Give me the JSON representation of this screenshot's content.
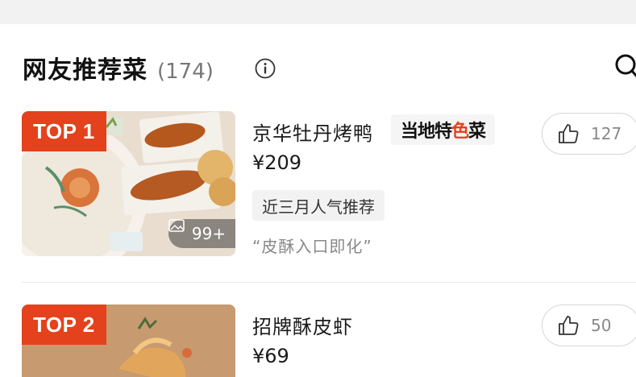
{
  "section": {
    "title": "网友推荐菜",
    "count": "(174)",
    "icons": {
      "info": "info-circle-icon",
      "search": "search-icon"
    }
  },
  "dishes": [
    {
      "rank": "TOP 1",
      "name": "京华牡丹烤鸭",
      "local_tag": {
        "text_a": "当地特",
        "text_b": "色",
        "text_c": "菜"
      },
      "price": "¥209",
      "recommend_tag": "近三月人气推荐",
      "quote": "“皮酥入口即化”",
      "photo_count": "99+",
      "likes": "127"
    },
    {
      "rank": "TOP 2",
      "name": "招牌酥皮虾",
      "price": "¥69",
      "likes": "50"
    }
  ],
  "colors": {
    "accent": "#e4421c",
    "tag_bg": "#f2f2f2",
    "muted": "#888888"
  }
}
